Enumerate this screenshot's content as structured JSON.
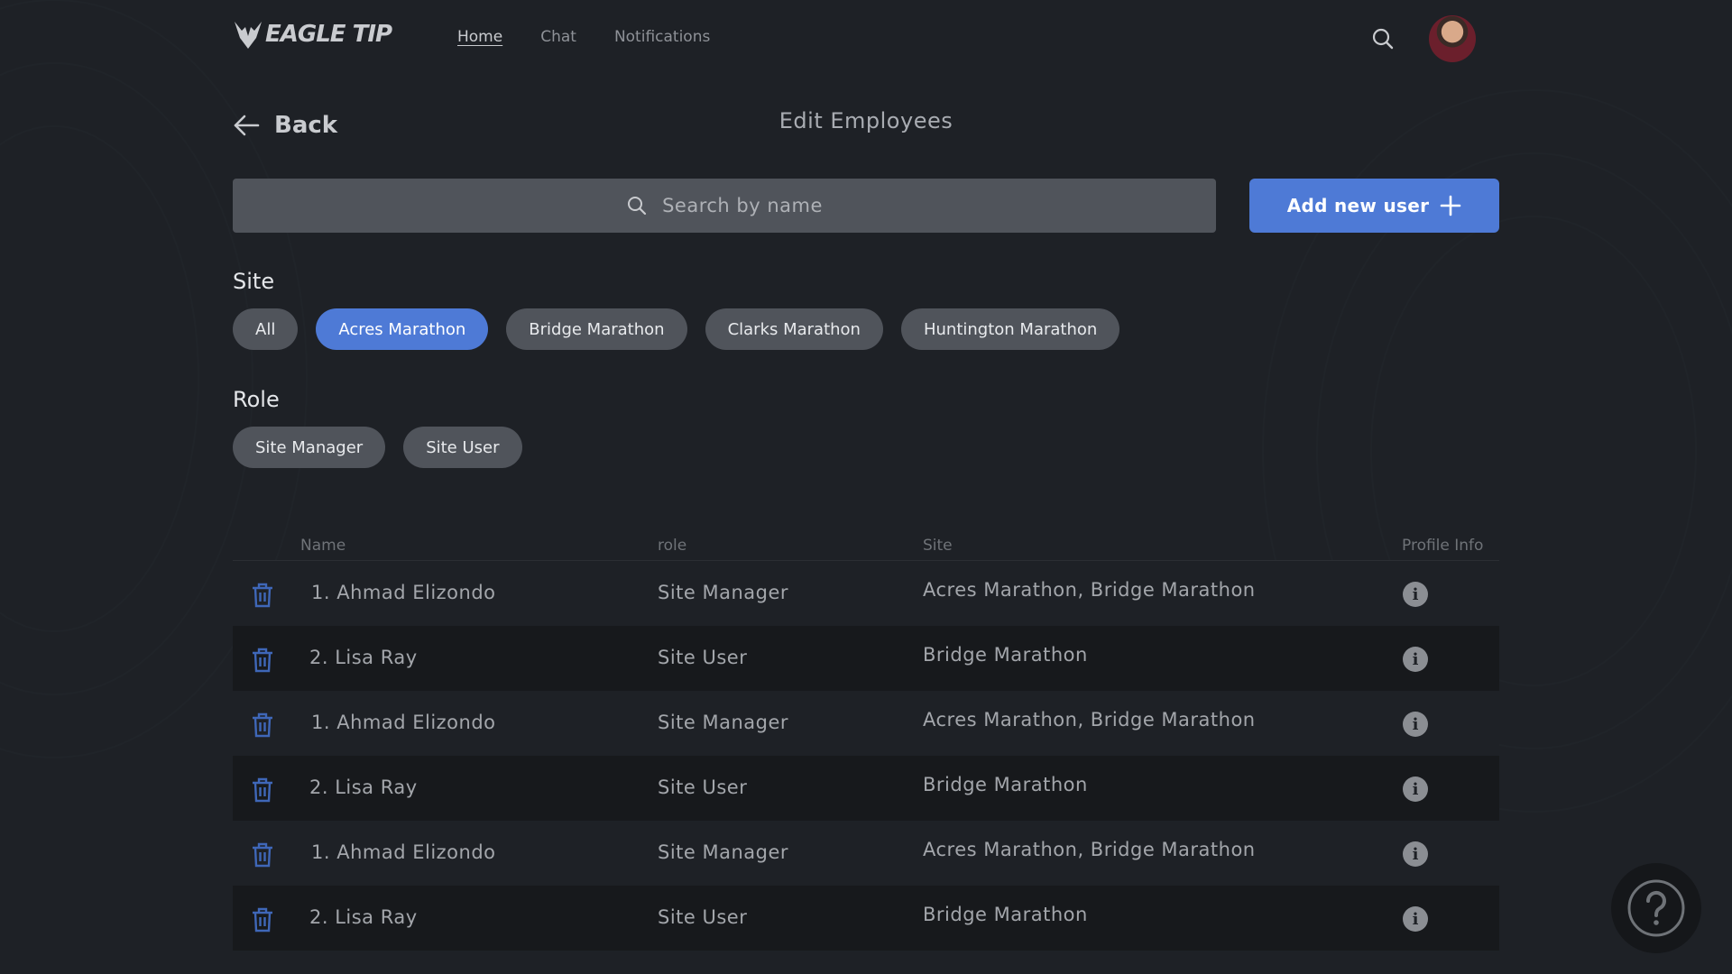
{
  "brand": {
    "name": "EAGLE TIP"
  },
  "nav": {
    "links": [
      {
        "label": "Home",
        "active": true
      },
      {
        "label": "Chat",
        "active": false
      },
      {
        "label": "Notifications",
        "active": false
      }
    ]
  },
  "header": {
    "back_label": "Back",
    "title": "Edit Employees"
  },
  "search": {
    "placeholder": "Search by name"
  },
  "add_button": {
    "label": "Add new user"
  },
  "filters": {
    "site": {
      "label": "Site",
      "options": [
        "All",
        "Acres Marathon",
        "Bridge Marathon",
        "Clarks Marathon",
        "Huntington Marathon"
      ],
      "selected": "Acres Marathon"
    },
    "role": {
      "label": "Role",
      "options": [
        "Site Manager",
        "Site User"
      ]
    }
  },
  "table": {
    "columns": [
      "Name",
      "role",
      "Site",
      "Profile Info"
    ],
    "rows": [
      {
        "name": "1. Ahmad Elizondo",
        "role": "Site Manager",
        "site": "Acres Marathon, Bridge Marathon"
      },
      {
        "name": "2. Lisa Ray",
        "role": "Site User",
        "site": "Bridge Marathon"
      },
      {
        "name": "1. Ahmad Elizondo",
        "role": "Site Manager",
        "site": "Acres Marathon, Bridge Marathon"
      },
      {
        "name": "2. Lisa Ray",
        "role": "Site User",
        "site": "Bridge Marathon"
      },
      {
        "name": "1. Ahmad Elizondo",
        "role": "Site Manager",
        "site": "Acres Marathon, Bridge Marathon"
      },
      {
        "name": "2. Lisa Ray",
        "role": "Site User",
        "site": "Bridge Marathon"
      }
    ]
  },
  "icons": {
    "search": "search-icon",
    "back": "arrow-left-icon",
    "add": "plus-icon",
    "delete": "trash-icon",
    "info": "info-icon",
    "help": "help-icon"
  },
  "colors": {
    "background": "#1e2126",
    "accent": "#4e7ad6",
    "chip": "#50545b",
    "trash": "#3f67b8"
  }
}
